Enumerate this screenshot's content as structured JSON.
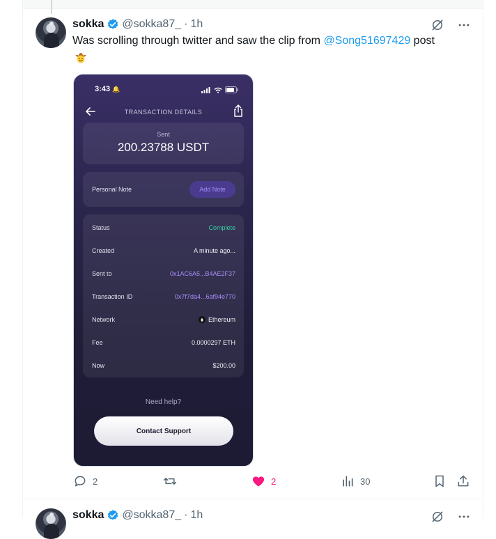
{
  "tweet": {
    "author_name": "sokka",
    "handle": "@sokka87_",
    "separator": "·",
    "time": "1h",
    "text_before": "Was scrolling through twitter and saw the clip from ",
    "mention": "@Song51697429",
    "text_after": " post",
    "emoji": "face-with-cowboy-hat-emoji"
  },
  "media": {
    "status_time": "3:43",
    "nav_title": "TRANSACTION DETAILS",
    "sent_label": "Sent",
    "sent_amount": "200.23788 USDT",
    "note_label": "Personal Note",
    "add_note_label": "Add Note",
    "details": [
      {
        "key": "Status",
        "value": "Complete"
      },
      {
        "key": "Created",
        "value": "A minute ago..."
      },
      {
        "key": "Sent to",
        "value": "0x1AC6A5...B4AE2F37"
      },
      {
        "key": "Transaction ID",
        "value": "0x7f7da4...6af94e770"
      },
      {
        "key": "Network",
        "value": "Ethereum"
      },
      {
        "key": "Fee",
        "value": "0.0000297 ETH"
      },
      {
        "key": "Now",
        "value": "$200.00"
      }
    ],
    "help_text": "Need help?",
    "contact_label": "Contact Support"
  },
  "actions": {
    "replies": "2",
    "reposts": "",
    "likes": "2",
    "views": "30"
  },
  "next_tweet": {
    "author_name": "sokka",
    "handle": "@sokka87_",
    "separator": "·",
    "time": "1h"
  },
  "colors": {
    "link": "#1d9bf0",
    "like": "#f91880",
    "verified": "#1d9bf0",
    "status_complete": "#35d0a5",
    "address_purple": "#a68cf5"
  }
}
